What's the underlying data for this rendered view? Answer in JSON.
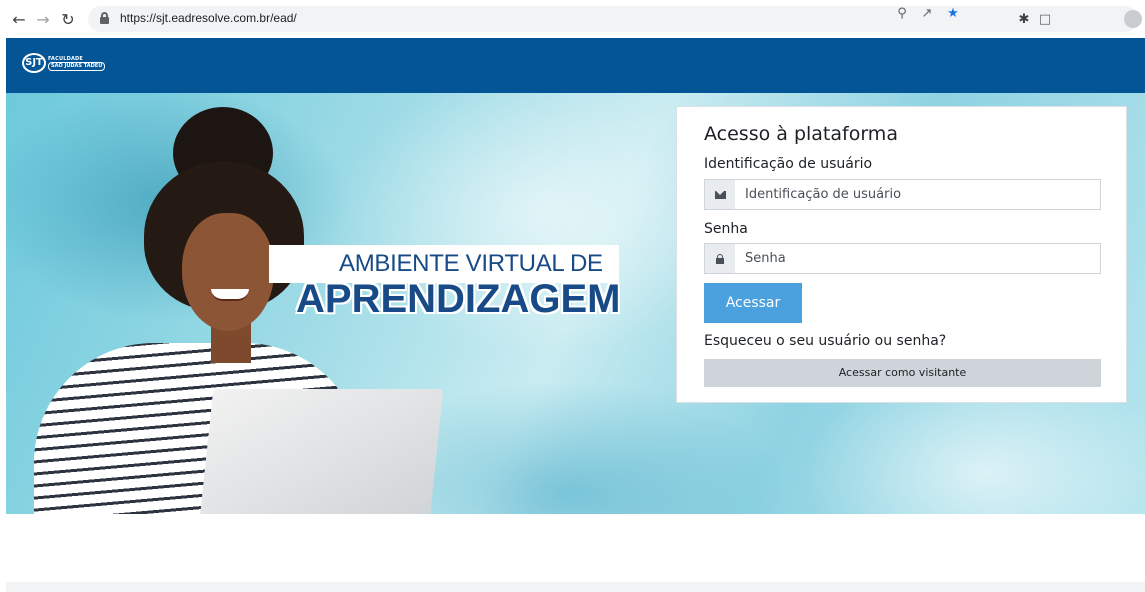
{
  "browser": {
    "url": "https://sjt.eadresolve.com.br/ead/"
  },
  "header": {
    "logo_mark": "SJT",
    "logo_line1": "FACULDADE",
    "logo_line2": "SÃO JUDAS TADEU"
  },
  "hero": {
    "tagline_top": "AMBIENTE VIRTUAL DE",
    "tagline_main": "APRENDIZAGEM"
  },
  "login": {
    "title": "Acesso à plataforma",
    "username_label": "Identificação de usuário",
    "username_placeholder": "Identificação de usuário",
    "password_label": "Senha",
    "password_placeholder": "Senha",
    "submit_label": "Acessar",
    "forgot_link": "Esqueceu o seu usuário ou senha?",
    "guest_label": "Acessar como visitante"
  },
  "colors": {
    "header_blue": "#035595",
    "primary_button": "#4ba0de",
    "heading_blue": "#174a86"
  }
}
